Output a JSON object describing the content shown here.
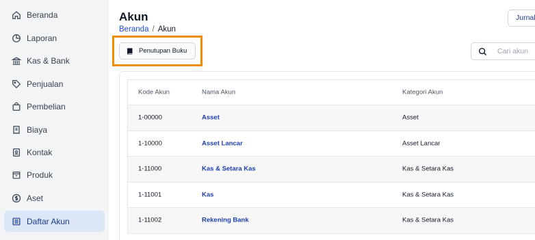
{
  "sidebar": {
    "items": [
      {
        "label": "Beranda",
        "icon": "home-icon"
      },
      {
        "label": "Laporan",
        "icon": "pie-chart-icon"
      },
      {
        "label": "Kas & Bank",
        "icon": "bank-icon"
      },
      {
        "label": "Penjualan",
        "icon": "tag-icon"
      },
      {
        "label": "Pembelian",
        "icon": "shopping-bag-icon"
      },
      {
        "label": "Biaya",
        "icon": "receipt-icon"
      },
      {
        "label": "Kontak",
        "icon": "contact-book-icon"
      },
      {
        "label": "Produk",
        "icon": "box-icon"
      },
      {
        "label": "Aset",
        "icon": "dollar-circle-icon"
      },
      {
        "label": "Daftar Akun",
        "icon": "list-icon"
      }
    ],
    "active_index": 9
  },
  "header": {
    "title": "Akun",
    "breadcrumb": {
      "home": "Beranda",
      "separator": "/",
      "current": "Akun"
    },
    "journal_button": "Jurnal"
  },
  "toolbar": {
    "closing_button": "Penutupan Buku",
    "search_placeholder": "Cari akun"
  },
  "colors": {
    "accent": "#1e40af",
    "highlight": "#f08c00",
    "active_nav_bg": "#dbe6f7"
  },
  "table": {
    "headers": [
      "Kode Akun",
      "Nama Akun",
      "Kategori Akun"
    ],
    "rows": [
      {
        "code": "1-00000",
        "name": "Asset",
        "category": "Asset"
      },
      {
        "code": "1-10000",
        "name": "Asset Lancar",
        "category": "Asset Lancar"
      },
      {
        "code": "1-11000",
        "name": "Kas & Setara Kas",
        "category": "Kas & Setara Kas"
      },
      {
        "code": "1-11001",
        "name": "Kas",
        "category": "Kas & Setara Kas"
      },
      {
        "code": "1-11002",
        "name": "Rekening Bank",
        "category": "Kas & Setara Kas"
      }
    ]
  }
}
